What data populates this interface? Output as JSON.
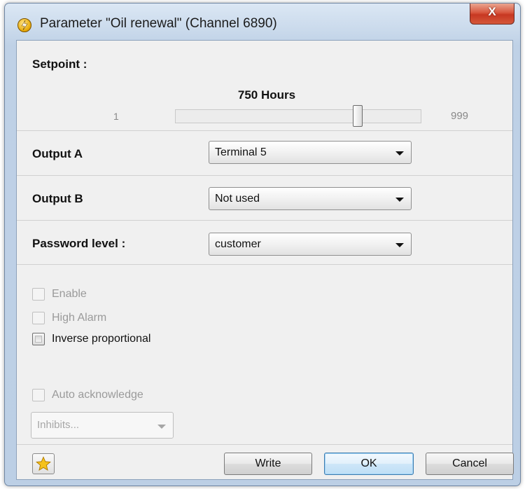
{
  "window": {
    "title": "Parameter \"Oil renewal\" (Channel 6890)",
    "close_symbol": "X"
  },
  "setpoint": {
    "label": "Setpoint :",
    "value_text": "750 Hours",
    "min_label": "1",
    "max_label": "999",
    "min": 1,
    "max": 999,
    "value": 750
  },
  "output_a": {
    "label": "Output A",
    "selected": "Terminal 5"
  },
  "output_b": {
    "label": "Output B",
    "selected": "Not used"
  },
  "password": {
    "label": "Password level :",
    "selected": "customer"
  },
  "options": {
    "enable": {
      "label": "Enable",
      "checked": false,
      "enabled": false
    },
    "high_alarm": {
      "label": "High Alarm",
      "checked": false,
      "enabled": false
    },
    "inverse": {
      "label": "Inverse proportional",
      "checked": false,
      "enabled": true
    },
    "auto_ack": {
      "label": "Auto acknowledge",
      "checked": false,
      "enabled": false
    }
  },
  "inhibits": {
    "placeholder": "Inhibits..."
  },
  "buttons": {
    "write": "Write",
    "ok": "OK",
    "cancel": "Cancel"
  },
  "icons": {
    "title": "lightning-icon",
    "favorite": "star-icon"
  },
  "colors": {
    "close_button": "#c73822",
    "ok_border": "#3d7bad",
    "star": "#f5c21b"
  }
}
